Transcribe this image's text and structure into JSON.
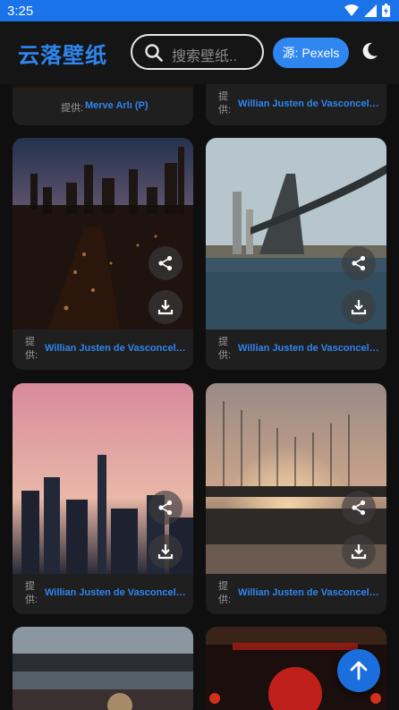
{
  "status": {
    "time": "3:25"
  },
  "header": {
    "title": "云落壁纸",
    "search_placeholder": "搜索壁纸..",
    "source_label": "源: Pexels"
  },
  "cards": [
    {
      "provided_label": "提供:",
      "author": "Merve Arlı (P)"
    },
    {
      "provided_label": "提供:",
      "author": "Willian Justen de Vasconcellos"
    },
    {
      "provided_label": "提供:",
      "author": "Willian Justen de Vasconcellos"
    },
    {
      "provided_label": "提供:",
      "author": "Willian Justen de Vasconcellos"
    },
    {
      "provided_label": "提供:",
      "author": "Willian Justen de Vasconcellos"
    },
    {
      "provided_label": "提供:",
      "author": "Willian Justen de Vasconcellos"
    }
  ],
  "icons": {
    "search": "search-icon",
    "moon": "moon-icon",
    "share": "share-icon",
    "download": "download-icon",
    "back_to_top": "arrow-up-icon"
  }
}
